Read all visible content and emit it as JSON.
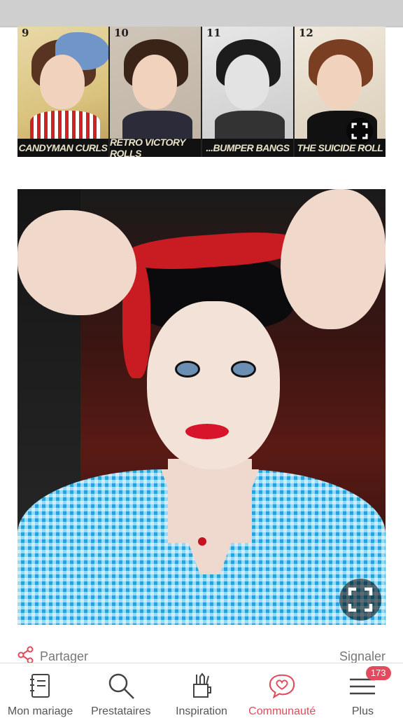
{
  "collage": {
    "panels": [
      {
        "num": "9",
        "caption": "CANDYMAN CURLS"
      },
      {
        "num": "10",
        "caption": "RETRO VICTORY ROLLS"
      },
      {
        "num": "11",
        "caption": "...BUMPER BANGS"
      },
      {
        "num": "12",
        "caption": "THE SUICIDE ROLL"
      }
    ]
  },
  "actions": {
    "share_label": "Partager",
    "report_label": "Signaler"
  },
  "nav": {
    "items": [
      {
        "label": "Mon mariage",
        "icon": "notebook-icon"
      },
      {
        "label": "Prestataires",
        "icon": "search-icon"
      },
      {
        "label": "Inspiration",
        "icon": "pencil-cup-icon"
      },
      {
        "label": "Communauté",
        "icon": "heart-chat-icon",
        "active": true
      },
      {
        "label": "Plus",
        "icon": "menu-icon",
        "badge": "173"
      }
    ]
  },
  "colors": {
    "accent": "#e34a5c",
    "muted_text": "#777777"
  }
}
